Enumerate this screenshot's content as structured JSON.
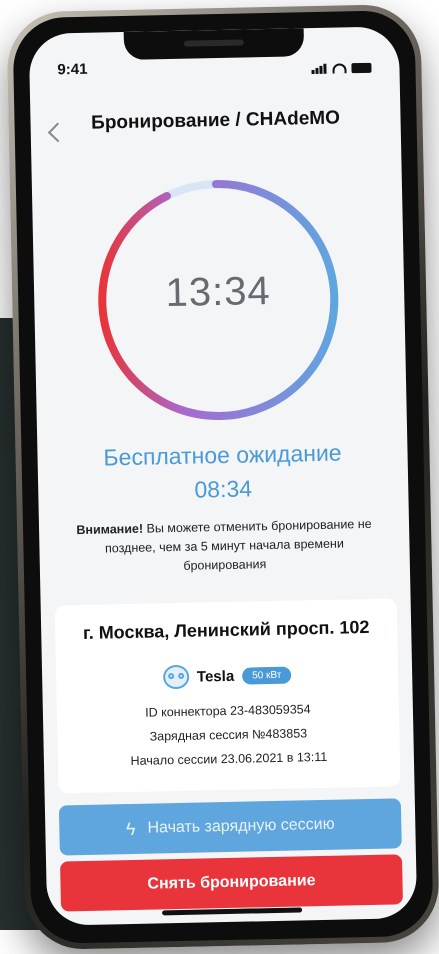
{
  "status": {
    "time": "9:41"
  },
  "header": {
    "title": "Бронирование / CHAdeMO"
  },
  "timer": {
    "value": "13:34",
    "progress": 0.93
  },
  "waiting": {
    "label": "Бесплатное ожидание",
    "time": "08:34"
  },
  "notice": {
    "bold": "Внимание!",
    "text": " Вы можете отменить бронирование не позднее, чем за 5 минут начала времени бронирования"
  },
  "station": {
    "address": "г. Москва, Ленинский просп. 102",
    "car": "Tesla",
    "power": "50 кВт",
    "connector": "ID коннектора 23-483059354",
    "session": "Зарядная сессия №483853",
    "start": "Начало сессии 23.06.2021 в 13:11"
  },
  "actions": {
    "start_label": "Начать зарядную сессию",
    "cancel_label": "Снять бронирование"
  },
  "colors": {
    "accent": "#4a9ad8",
    "danger": "#e8343a",
    "ring_start": "#e8343a",
    "ring_end": "#5fa6df"
  }
}
